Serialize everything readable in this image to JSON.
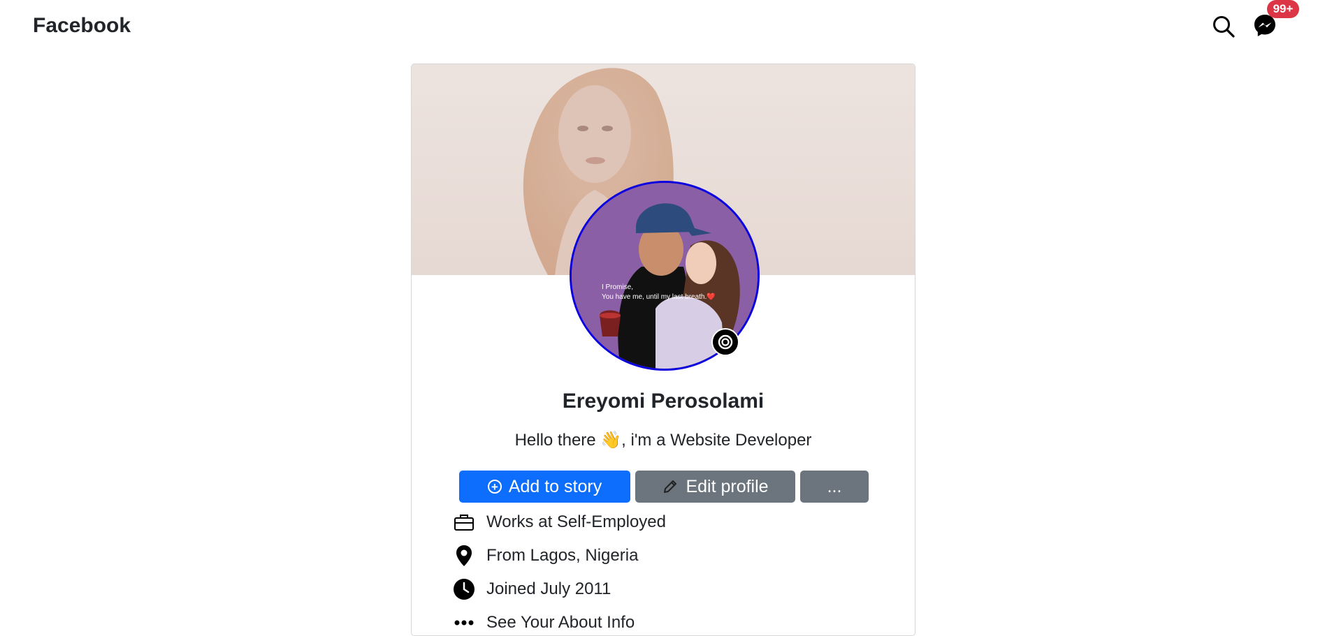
{
  "header": {
    "brand": "Facebook",
    "notifications_badge": "99+",
    "icons": {
      "search": "search-icon",
      "messenger": "messenger-icon"
    }
  },
  "profile": {
    "name": "Ereyomi Perosolami",
    "bio": "Hello there 👋, i'm a Website Developer",
    "avatar_caption_line1": "I Promise,",
    "avatar_caption_line2": "You have me, until my last breath.❤️",
    "avatar_border_color": "#0b00e0"
  },
  "actions": {
    "add_story": "Add to story",
    "edit_profile": "Edit profile",
    "more": "..."
  },
  "colors": {
    "primary": "#0d6efd",
    "secondary": "#6c757d",
    "badge": "#dc3545"
  },
  "info": [
    {
      "icon": "briefcase-icon",
      "text": "Works at Self-Employed"
    },
    {
      "icon": "location-pin-icon",
      "text": "From Lagos, Nigeria"
    },
    {
      "icon": "clock-icon",
      "text": "Joined July 2011"
    },
    {
      "icon": "more-dots-icon",
      "text": "See Your About Info"
    }
  ]
}
